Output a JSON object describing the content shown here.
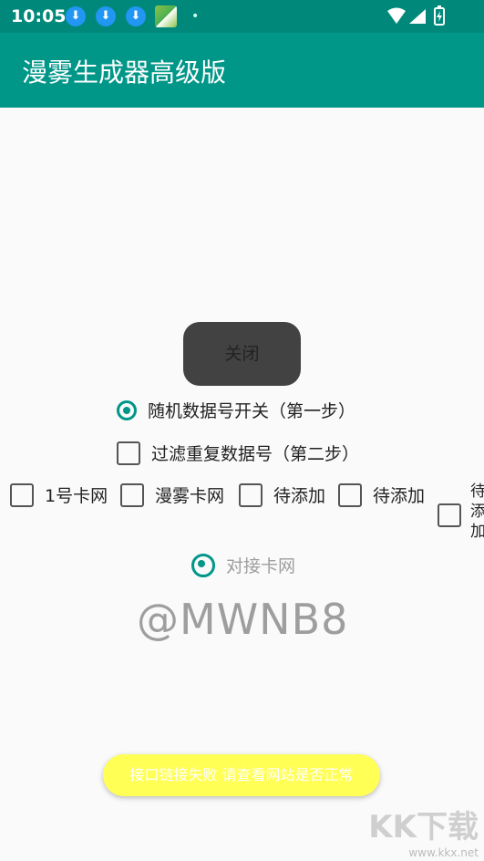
{
  "status_bar": {
    "time": "10:05",
    "download_icon": "download-arrow"
  },
  "app": {
    "title": "漫雾生成器高级版",
    "accent_color": "#009688"
  },
  "close_button": {
    "label": "关闭"
  },
  "options": {
    "random_switch": {
      "label": "随机数据号开关（第一步）",
      "checked": true
    },
    "filter_dup": {
      "label": "过滤重复数据号（第二步）",
      "checked": false
    },
    "providers": [
      {
        "label": "1号卡网",
        "checked": false
      },
      {
        "label": "漫雾卡网",
        "checked": false
      },
      {
        "label": "待添加",
        "checked": false
      },
      {
        "label": "待添加",
        "checked": false
      },
      {
        "label": "待添加",
        "checked": false
      }
    ],
    "connect": {
      "label": "对接卡网",
      "checked": true
    }
  },
  "handle": "@MWNB8",
  "toast": "接口链接失败 请查看网站是否正常",
  "watermark": {
    "big": "KK下载",
    "small": "www.kkx.net"
  }
}
